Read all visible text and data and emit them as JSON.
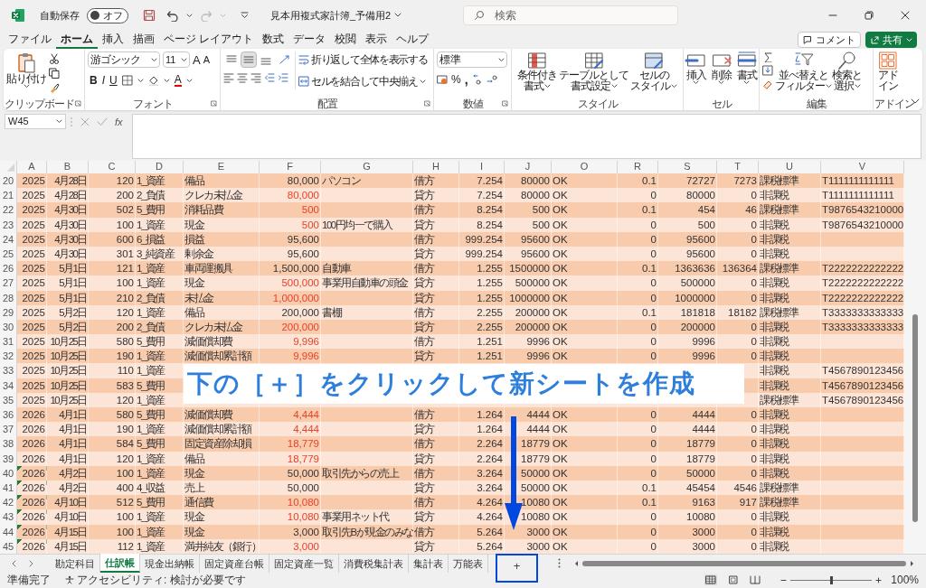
{
  "title_bar": {
    "autosave_label": "自動保存",
    "autosave": {
      "on": false,
      "label": "オフ"
    },
    "document_title": "見本用複式家計簿_予備用2",
    "search": {
      "placeholder": "検索"
    }
  },
  "menu": {
    "tabs": [
      {
        "label": "ファイル",
        "selected": false
      },
      {
        "label": "ホーム",
        "selected": true
      },
      {
        "label": "挿入",
        "selected": false
      },
      {
        "label": "描画",
        "selected": false
      },
      {
        "label": "ページ レイアウト",
        "selected": false
      },
      {
        "label": "数式",
        "selected": false
      },
      {
        "label": "データ",
        "selected": false
      },
      {
        "label": "校閲",
        "selected": false
      },
      {
        "label": "表示",
        "selected": false
      },
      {
        "label": "ヘルプ",
        "selected": false
      }
    ],
    "comment_button": "コメント",
    "share_button": "共有"
  },
  "ribbon": {
    "clipboard": {
      "paste": "貼り付け",
      "group": "クリップボード"
    },
    "font": {
      "font_name": "游ゴシック",
      "font_size": "11",
      "grow": "A",
      "shrink": "A",
      "styles": [
        "B",
        "I",
        "U"
      ],
      "font_color": "A",
      "group": "フォント"
    },
    "alignment": {
      "vertical": [
        {
          "selected": false
        },
        {
          "selected": true
        },
        {
          "selected": false
        }
      ],
      "wrap_text": "折り返して全体を表示する",
      "merge": "セルを結合して中央揃え",
      "group": "配置"
    },
    "number": {
      "format": "標準",
      "percent": "%",
      "comma": ",",
      "group": "数値"
    },
    "styles": {
      "buttons": [
        {
          "lines": [
            "条件付き",
            "書式"
          ]
        },
        {
          "lines": [
            "テーブルとして",
            "書式設定"
          ]
        },
        {
          "lines": [
            "セルの",
            "スタイル"
          ]
        }
      ],
      "group": "スタイル"
    },
    "cells": {
      "buttons": [
        "挿入",
        "削除",
        "書式"
      ],
      "group": "セル"
    },
    "editing": {
      "sort": [
        "並べ替えと",
        "フィルター"
      ],
      "find": [
        "検索と",
        "選択"
      ],
      "group": "編集"
    },
    "addins": {
      "button": [
        "アド",
        "イン"
      ],
      "group": "アドイン"
    }
  },
  "formula_bar": {
    "name_box": "W45",
    "fx": "fx"
  },
  "sheet": {
    "columns": [
      "A",
      "B",
      "C",
      "D",
      "E",
      "F",
      "G",
      "H",
      "I",
      "J",
      "O",
      "R",
      "S",
      "T",
      "U",
      "V"
    ],
    "rows": [
      {
        "num": "20",
        "cells": [
          "2025",
          "4月28日",
          "120",
          "1_資産",
          "備品",
          "80,000",
          "パソコン",
          "借方",
          "7.254",
          "80000",
          "OK",
          "0.1",
          "72727",
          "7273",
          "課税標準",
          "T1111111111111"
        ],
        "red_amount": false,
        "flag": false,
        "group_end": false
      },
      {
        "num": "21",
        "cells": [
          "2025",
          "4月28日",
          "200",
          "2_負債",
          "クレカ未払金",
          "80,000",
          null,
          "貸方",
          "7.254",
          "80000",
          "OK",
          "0",
          "80000",
          "0",
          "非課税",
          "T1111111111111"
        ],
        "red_amount": true,
        "flag": false,
        "group_end": false
      },
      {
        "num": "22",
        "cells": [
          "2025",
          "4月30日",
          "502",
          "5_費用",
          "消耗品費",
          "500",
          null,
          "借方",
          "8.254",
          "500",
          "OK",
          "0.1",
          "454",
          "46",
          "課税標準",
          "T9876543210000"
        ],
        "red_amount": true,
        "flag": false,
        "group_end": false
      },
      {
        "num": "23",
        "cells": [
          "2025",
          "4月30日",
          "100",
          "1_資産",
          "現金",
          "500",
          "100円均一で購入",
          "貸方",
          "8.254",
          "500",
          "OK",
          "0",
          "500",
          "0",
          "非課税",
          "T9876543210000"
        ],
        "red_amount": true,
        "flag": false,
        "group_end": false
      },
      {
        "num": "24",
        "cells": [
          "2025",
          "4月30日",
          "600",
          "6_損益",
          "損益",
          "95,600",
          null,
          "借方",
          "999.254",
          "95600",
          "OK",
          "0",
          "95600",
          "0",
          "非課税",
          null
        ],
        "red_amount": false,
        "flag": false,
        "group_end": false
      },
      {
        "num": "25",
        "cells": [
          "2025",
          "4月30日",
          "301",
          "3_純資産",
          "剰余金",
          "95,600",
          null,
          "貸方",
          "999.254",
          "95600",
          "OK",
          "0",
          "95600",
          "0",
          "非課税",
          null
        ],
        "red_amount": false,
        "flag": false,
        "group_end": false
      },
      {
        "num": "26",
        "cells": [
          "2025",
          "5月1日",
          "121",
          "1_資産",
          "車両運搬具",
          "1,500,000",
          "自動車",
          "借方",
          "1.255",
          "1500000",
          "OK",
          "0.1",
          "1363636",
          "136364",
          "課税標準",
          "T2222222222222"
        ],
        "red_amount": false,
        "flag": false,
        "group_end": false
      },
      {
        "num": "27",
        "cells": [
          "2025",
          "5月1日",
          "100",
          "1_資産",
          "現金",
          "500,000",
          "事業用自動車の頭金",
          "貸方",
          "1.255",
          "500000",
          "OK",
          "0",
          "500000",
          "0",
          "非課税",
          "T2222222222222"
        ],
        "red_amount": true,
        "flag": false,
        "group_end": false
      },
      {
        "num": "28",
        "cells": [
          "2025",
          "5月1日",
          "210",
          "2_負債",
          "未払金",
          "1,000,000",
          null,
          "貸方",
          "1.255",
          "1000000",
          "OK",
          "0",
          "1000000",
          "0",
          "非課税",
          "T2222222222222"
        ],
        "red_amount": true,
        "flag": false,
        "group_end": false
      },
      {
        "num": "29",
        "cells": [
          "2025",
          "5月2日",
          "120",
          "1_資産",
          "備品",
          "200,000",
          "書棚",
          "借方",
          "2.255",
          "200000",
          "OK",
          "0.1",
          "181818",
          "18182",
          "課税標準",
          "T3333333333333"
        ],
        "red_amount": false,
        "flag": false,
        "group_end": false
      },
      {
        "num": "30",
        "cells": [
          "2025",
          "5月2日",
          "200",
          "2_負債",
          "クレカ未払金",
          "200,000",
          null,
          "貸方",
          "2.255",
          "200000",
          "OK",
          "0",
          "200000",
          "0",
          "非課税",
          "T3333333333333"
        ],
        "red_amount": true,
        "flag": false,
        "group_end": true
      },
      {
        "num": "31",
        "cells": [
          "2025",
          "10月25日",
          "580",
          "5_費用",
          "減価償却費",
          "9,996",
          null,
          "借方",
          "1.251",
          "9996",
          "OK",
          "0",
          "9996",
          "0",
          "非課税",
          null
        ],
        "red_amount": true,
        "flag": false,
        "group_end": false
      },
      {
        "num": "32",
        "cells": [
          "2025",
          "10月25日",
          "190",
          "1_資産",
          "減価償却累計額",
          "9,996",
          null,
          "貸方",
          "1.251",
          "9996",
          "OK",
          "0",
          "9996",
          "0",
          "非課税",
          null
        ],
        "red_amount": true,
        "flag": false,
        "group_end": false
      },
      {
        "num": "33",
        "cells": [
          "2025",
          "10月25日",
          "110",
          "1_資産",
          null,
          null,
          null,
          null,
          null,
          null,
          null,
          null,
          null,
          null,
          "非課税",
          "T4567890123456"
        ],
        "flag": false,
        "group_end": false
      },
      {
        "num": "34",
        "cells": [
          "2025",
          "10月25日",
          "583",
          "5_費用",
          null,
          null,
          null,
          null,
          null,
          null,
          null,
          null,
          null,
          null,
          "非課税",
          "T4567890123456"
        ],
        "flag": false,
        "group_end": false
      },
      {
        "num": "35",
        "cells": [
          "2025",
          "10月25日",
          "120",
          "1_資産",
          null,
          null,
          null,
          null,
          null,
          null,
          null,
          null,
          null,
          null,
          "課税標準",
          "T4567890123456"
        ],
        "flag": false,
        "group_end": true
      },
      {
        "num": "36",
        "cells": [
          "2026",
          "4月1日",
          "580",
          "5_費用",
          "減価償却費",
          "4,444",
          null,
          "借方",
          "1.264",
          "4444",
          "OK",
          "0",
          "4444",
          "0",
          "非課税",
          null
        ],
        "red_amount": true,
        "flag": false,
        "group_end": false
      },
      {
        "num": "37",
        "cells": [
          "2026",
          "4月1日",
          "190",
          "1_資産",
          "減価償却累計額",
          "4,444",
          null,
          "貸方",
          "1.264",
          "4444",
          "OK",
          "0",
          "4444",
          "0",
          "非課税",
          null
        ],
        "red_amount": true,
        "flag": false,
        "group_end": false
      },
      {
        "num": "38",
        "cells": [
          "2026",
          "4月1日",
          "584",
          "5_費用",
          "固定資産除却損",
          "18,779",
          null,
          "借方",
          "2.264",
          "18779",
          "OK",
          "0",
          "18779",
          "0",
          "非課税",
          null
        ],
        "red_amount": true,
        "flag": false,
        "group_end": false
      },
      {
        "num": "39",
        "cells": [
          "2026",
          "4月1日",
          "120",
          "1_資産",
          "備品",
          "18,779",
          null,
          "貸方",
          "2.264",
          "18779",
          "OK",
          "0",
          "18779",
          "0",
          "非課税",
          null
        ],
        "red_amount": true,
        "flag": false,
        "group_end": false
      },
      {
        "num": "40",
        "cells": [
          "2026",
          "4月2日",
          "100",
          "1_資産",
          "現金",
          "50,000",
          "取引先からの売上",
          "借方",
          "3.264",
          "50000",
          "OK",
          "0",
          "50000",
          "0",
          "非課税",
          null
        ],
        "red_amount": false,
        "flag": true,
        "group_end": false
      },
      {
        "num": "41",
        "cells": [
          "2026",
          "4月2日",
          "400",
          "4_収益",
          "売上",
          "50,000",
          null,
          "貸方",
          "3.264",
          "50000",
          "OK",
          "0.1",
          "45454",
          "4546",
          "課税標準",
          null
        ],
        "red_amount": false,
        "flag": true,
        "group_end": false
      },
      {
        "num": "42",
        "cells": [
          "2026",
          "4月10日",
          "512",
          "5_費用",
          "通信費",
          "10,080",
          null,
          "借方",
          "4.264",
          "10080",
          "OK",
          "0.1",
          "9163",
          "917",
          "課税標準",
          null
        ],
        "red_amount": true,
        "flag": true,
        "group_end": false
      },
      {
        "num": "43",
        "cells": [
          "2026",
          "4月10日",
          "100",
          "1_資産",
          "現金",
          "10,080",
          "事業用ネット代",
          "貸方",
          "4.264",
          "10080",
          "OK",
          "0",
          "10080",
          "0",
          "非課税",
          null
        ],
        "red_amount": true,
        "flag": true,
        "group_end": false
      },
      {
        "num": "44",
        "cells": [
          "2026",
          "4月15日",
          "100",
          "1_資産",
          "現金",
          "3,000",
          "取引先Bが現金のみな",
          "借方",
          "5.264",
          "3000",
          "OK",
          "0",
          "3000",
          "0",
          "非課税",
          null
        ],
        "red_amount": false,
        "flag": true,
        "group_end": false
      },
      {
        "num": "45",
        "cells": [
          "2026",
          "4月15日",
          "112",
          "1_資産",
          "満井純友（銀行）",
          "3,000",
          null,
          "貸方",
          "5.264",
          "3000",
          "OK",
          "0",
          "3000",
          "0",
          "非課税",
          null
        ],
        "red_amount": true,
        "flag": true,
        "group_end": false
      }
    ]
  },
  "annotation": {
    "banner": "下の［＋］をクリックして新シートを作成"
  },
  "sheet_tabs": {
    "tabs": [
      {
        "label": "勘定科目",
        "selected": false
      },
      {
        "label": "仕訳帳",
        "selected": true
      },
      {
        "label": "現金出納帳",
        "selected": false
      },
      {
        "label": "固定資産台帳",
        "selected": false
      },
      {
        "label": "固定資産一覧",
        "selected": false
      },
      {
        "label": "消費税集計表",
        "selected": false
      },
      {
        "label": "集計表",
        "selected": false
      },
      {
        "label": "万能表",
        "selected": false
      }
    ],
    "add_button": "+"
  },
  "status_bar": {
    "ready": "準備完了",
    "accessibility": "アクセシビリティ: 検討が必要です",
    "zoom": {
      "level": 0.5,
      "reading": "100%"
    }
  }
}
